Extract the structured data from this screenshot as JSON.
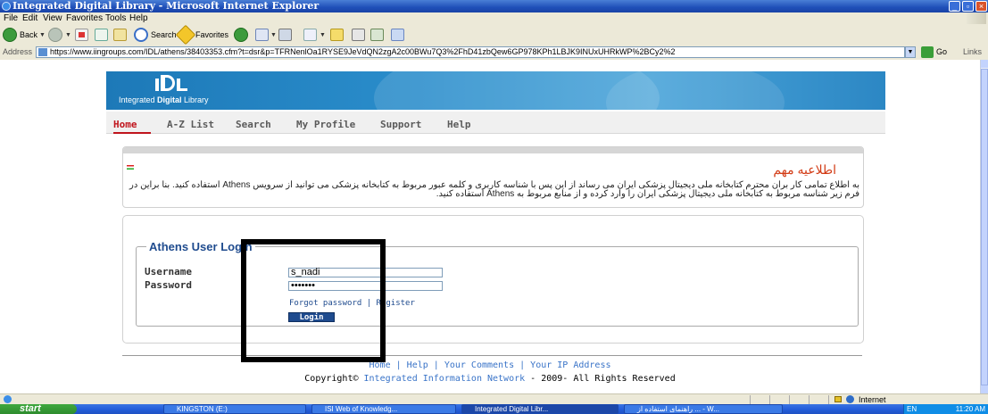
{
  "window": {
    "title": "Integrated Digital Library - Microsoft Internet Explorer",
    "controls": [
      "minimize",
      "maximize",
      "close"
    ]
  },
  "menubar": [
    "File",
    "Edit",
    "View",
    "Favorites",
    "Tools",
    "Help"
  ],
  "toolbar": {
    "back_label": "Back",
    "search_label": "Search",
    "favorites_label": "Favorites"
  },
  "addressbar": {
    "label": "Address",
    "url": "https://www.iingroups.com/IDL/athens/38403353.cfm?t=dsr&p=TFRNenlOa1RYSE9JeVdQN2zgA2c00BWu7Q3%2FhD41zbQew6GP978KPh1LBJK9INUxUHRkWP%2BCy2%2",
    "go_label": "Go",
    "links_label": "Links"
  },
  "site": {
    "tagline_pre": "Integrated ",
    "tagline_bold": "Digital",
    "tagline_post": " Library",
    "nav": [
      {
        "label": "Home",
        "active": true
      },
      {
        "label": "A-Z List",
        "active": false
      },
      {
        "label": "Search",
        "active": false
      },
      {
        "label": "My Profile",
        "active": false
      },
      {
        "label": "Support",
        "active": false
      },
      {
        "label": "Help",
        "active": false
      }
    ],
    "accent_color": "#c0141c"
  },
  "notice": {
    "title": "اطلاعیه مهم",
    "body": "به اطلاع تمامی کار بران محترم کتابخانه ملی دیجیتال پزشکی ایران می رساند از این پس با شناسه کاربری و کلمه عبور مربوط به کتابخانه پزشکی می توانید از سرویس Athens استفاده کنید. بنا براین در فرم زیر شناسه مربوط به کتابخانه ملی دیجیتال پزشکی ایران را وارد کرده و از منابع مربوط به Athens استفاده کنید."
  },
  "login": {
    "legend": "Athens User Login",
    "username_label": "Username",
    "username_value": "s_nadi",
    "password_label": "Password",
    "password_value": "•••••••",
    "forgot_label": "Forgot password",
    "separator": "|",
    "register_label": "Register",
    "button_label": "Login"
  },
  "footer": {
    "links": [
      "Home",
      "Help",
      "Your Comments",
      "Your IP Address"
    ],
    "copyright_pre": "Copyright© ",
    "copyright_org": "Integrated Information Network",
    "copyright_post": " - 2009- All Rights Reserved"
  },
  "statusbar": {
    "zone": "Internet"
  },
  "taskbar": {
    "start_label": "start",
    "tasks": [
      {
        "label": "KINGSTON (E:)",
        "active": false
      },
      {
        "label": "ISI Web of Knowledg...",
        "active": false
      },
      {
        "label": "Integrated Digital Libr...",
        "active": true
      },
      {
        "label": "راهنمای استفاده از ... - W...",
        "active": false
      }
    ],
    "tray_lang": "EN",
    "clock": "11:20 AM"
  }
}
